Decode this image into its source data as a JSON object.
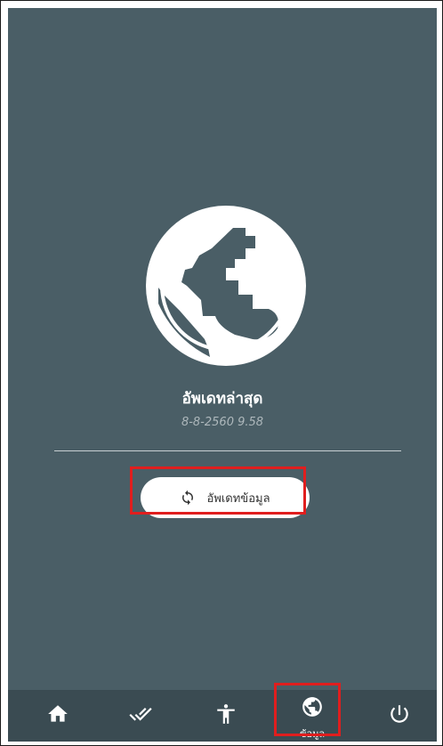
{
  "status": {
    "title": "อัพเดทล่าสุด",
    "last_updated": "8-8-2560  9.58"
  },
  "actions": {
    "update_label": "อัพเดทข้อมูล"
  },
  "nav": {
    "items": [
      {
        "icon": "home-icon"
      },
      {
        "icon": "double-check-icon"
      },
      {
        "icon": "accessibility-person-icon"
      },
      {
        "icon": "globe-icon",
        "label": "ข้อมูล",
        "active": true
      },
      {
        "icon": "power-icon"
      }
    ]
  },
  "colors": {
    "background": "#4a5e66",
    "navbar": "#3a4b52",
    "highlight": "#e01e1e"
  }
}
